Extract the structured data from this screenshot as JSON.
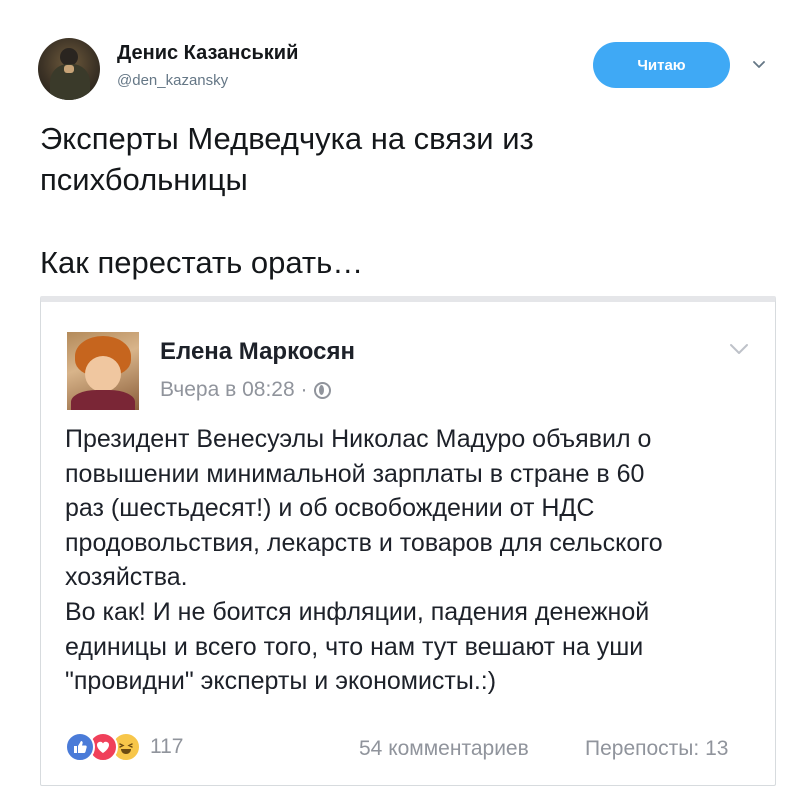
{
  "tweet": {
    "author_name": "Денис Казанський",
    "author_handle": "@den_kazansky",
    "follow_button_label": "Читаю",
    "text_line1": "Эксперты Медведчука на связи из",
    "text_line2": "психбольницы",
    "text_line3": "Как перестать орать…"
  },
  "embedded_post": {
    "author_name": "Елена Маркосян",
    "timestamp": "Вчера в 08:28 ·",
    "privacy_icon": "globe-icon",
    "body_lines": [
      "Президент Венесуэлы Николас Мадуро объявил о",
      "повышении минимальной зарплаты в стране в 60",
      "раз (шестьдесят!) и об освобождении от НДС",
      "продовольствия, лекарств и товаров для сельского",
      "хозяйства.",
      "Во как! И не боится инфляции, падения денежной",
      "единицы и всего того, что  нам тут вешают на уши",
      "\"провидни\" эксперты и экономисты.:)"
    ],
    "reactions": {
      "icons": [
        "like-icon",
        "love-icon",
        "haha-icon"
      ],
      "count": "117"
    },
    "comments_label": "54 комментариев",
    "shares_label": "Перепосты: 13"
  },
  "colors": {
    "follow_button": "#3fa9f5",
    "muted_text": "#90949c",
    "handle_text": "#657786"
  }
}
